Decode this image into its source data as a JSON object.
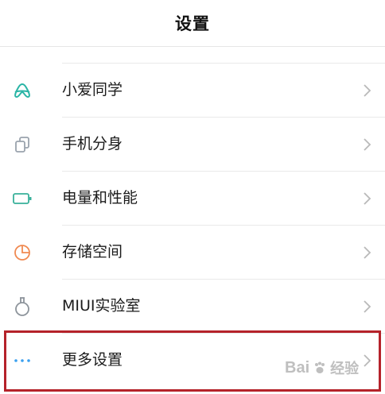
{
  "header": {
    "title": "设置"
  },
  "items": [
    {
      "label": "小爱同学",
      "icon": "xiaoai-icon",
      "color": "#2bb5a6"
    },
    {
      "label": "手机分身",
      "icon": "phone-clone-icon",
      "color": "#9aa3ad"
    },
    {
      "label": "电量和性能",
      "icon": "battery-icon",
      "color": "#38b09a"
    },
    {
      "label": "存储空间",
      "icon": "storage-pie-icon",
      "color": "#f08a52"
    },
    {
      "label": "MIUI实验室",
      "icon": "lab-flask-icon",
      "color": "#8d949b"
    },
    {
      "label": "更多设置",
      "icon": "more-dots-icon",
      "color": "#3aa0f0"
    }
  ],
  "highlight": {
    "color": "#b5222a",
    "target": "更多设置"
  },
  "watermark": {
    "brand": "Bai",
    "text": "经验"
  }
}
